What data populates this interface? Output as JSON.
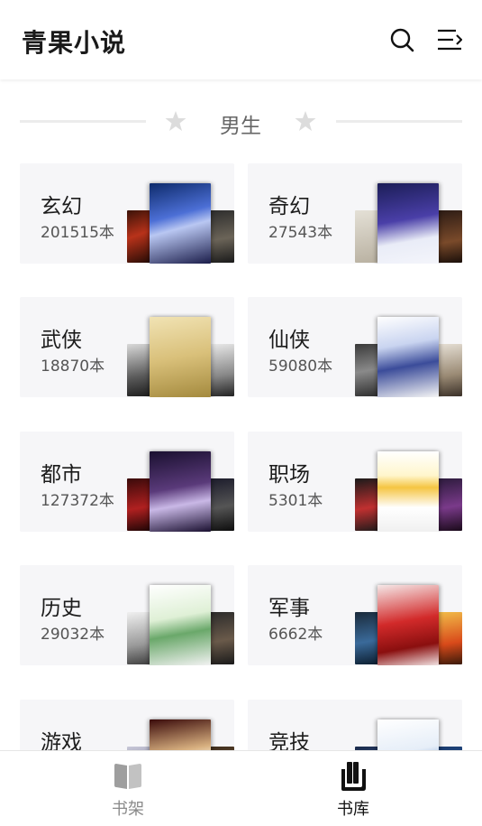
{
  "header": {
    "title": "青果小说",
    "search_icon": "search-icon",
    "menu_icon": "menu-arrow-icon"
  },
  "section": {
    "title": "男生"
  },
  "colors": {
    "card_bg": "#f6f6f8",
    "accent": "#111111",
    "muted": "#8a8a8a"
  },
  "categories": [
    {
      "name": "玄幻",
      "count": "201515本"
    },
    {
      "name": "奇幻",
      "count": "27543本"
    },
    {
      "name": "武侠",
      "count": "18870本"
    },
    {
      "name": "仙侠",
      "count": "59080本"
    },
    {
      "name": "都市",
      "count": "127372本"
    },
    {
      "name": "职场",
      "count": "5301本"
    },
    {
      "name": "历史",
      "count": "29032本"
    },
    {
      "name": "军事",
      "count": "6662本"
    },
    {
      "name": "游戏",
      "count": ""
    },
    {
      "name": "竞技",
      "count": ""
    }
  ],
  "tabs": [
    {
      "label": "书架",
      "icon": "book-open-icon"
    },
    {
      "label": "书库",
      "icon": "library-icon"
    }
  ]
}
